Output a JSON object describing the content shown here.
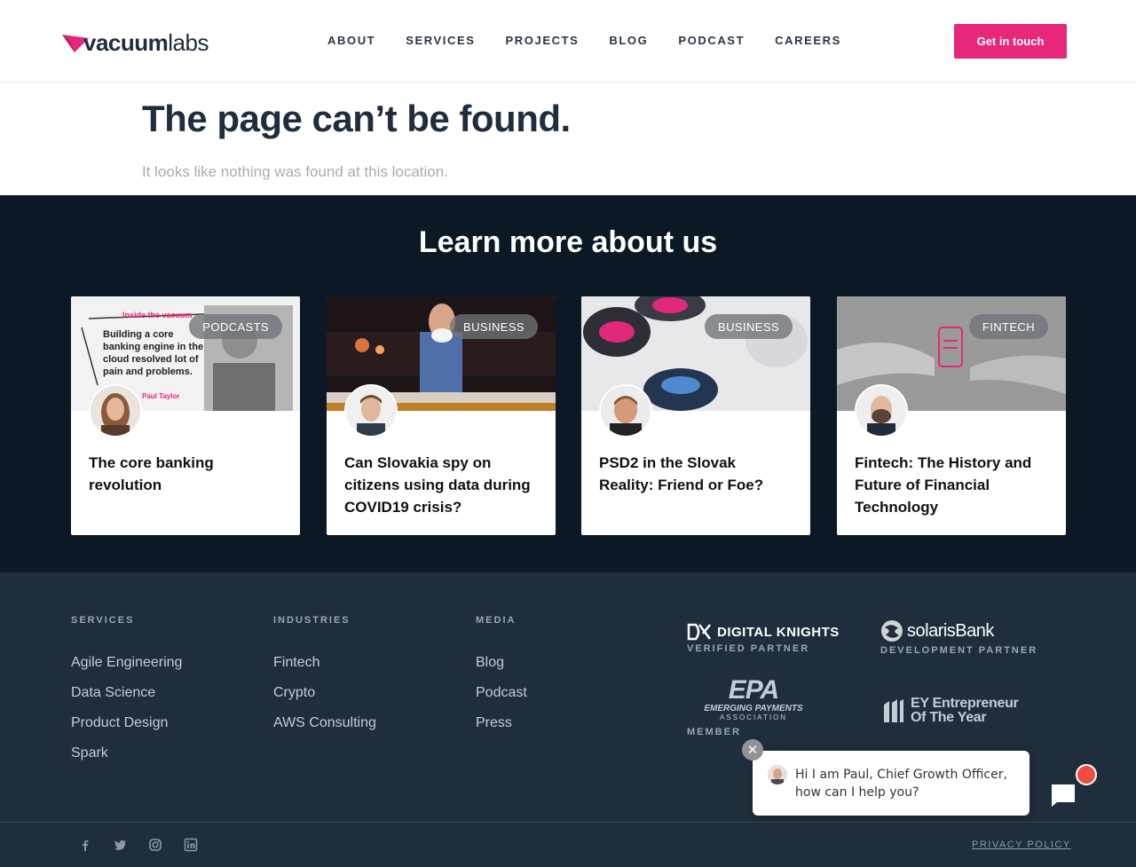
{
  "header": {
    "logo_bold": "vacuum",
    "logo_light": "labs",
    "nav": [
      "ABOUT",
      "SERVICES",
      "PROJECTS",
      "BLOG",
      "PODCAST",
      "CAREERS"
    ],
    "cta": "Get in touch"
  },
  "notfound": {
    "title": "The page can’t be found.",
    "subtitle": "It looks like nothing was found at this location."
  },
  "learn": {
    "title": "Learn more about us",
    "cards": [
      {
        "badge": "PODCASTS",
        "title": "The core banking revolution",
        "image_text": [
          "Inside the vacuum",
          "Building a core",
          "banking engine in the",
          "cloud resolved lot of",
          "pain and problems.",
          "Paul Taylor"
        ]
      },
      {
        "badge": "BUSINESS",
        "title": "Can Slovakia spy on citizens using data during COVID19 crisis?"
      },
      {
        "badge": "BUSINESS",
        "title": "PSD2 in the Slovak Reality: Friend or Foe?"
      },
      {
        "badge": "FINTECH",
        "title": "Fintech: The History and Future of Financial Technology"
      }
    ]
  },
  "footer": {
    "columns": [
      {
        "heading": "SERVICES",
        "links": [
          "Agile Engineering",
          "Data Science",
          "Product Design",
          "Spark"
        ]
      },
      {
        "heading": "INDUSTRIES",
        "links": [
          "Fintech",
          "Crypto",
          "AWS Consulting"
        ]
      },
      {
        "heading": "MEDIA",
        "links": [
          "Blog",
          "Podcast",
          "Press"
        ]
      }
    ],
    "partners": [
      {
        "name": "DIGITAL KNIGHTS",
        "sub": "VERIFIED PARTNER"
      },
      {
        "name": "solarisBank",
        "sub": "DEVELOPMENT PARTNER"
      },
      {
        "name": "EPA",
        "name_line": "EMERGING PAYMENTS",
        "name_line2": "ASSOCIATION",
        "sub": "MEMBER"
      },
      {
        "name": "EY Entrepreneur",
        "name_line": "Of The Year"
      }
    ],
    "social": [
      "facebook-icon",
      "twitter-icon",
      "instagram-icon",
      "linkedin-icon"
    ],
    "privacy": "PRIVACY POLICY"
  },
  "chat": {
    "message": "Hi I am Paul, Chief Growth Officer, how can I help you?"
  },
  "colors": {
    "accent": "#e6277a",
    "dark": "#0c1823",
    "footer": "#1f2d3d"
  }
}
